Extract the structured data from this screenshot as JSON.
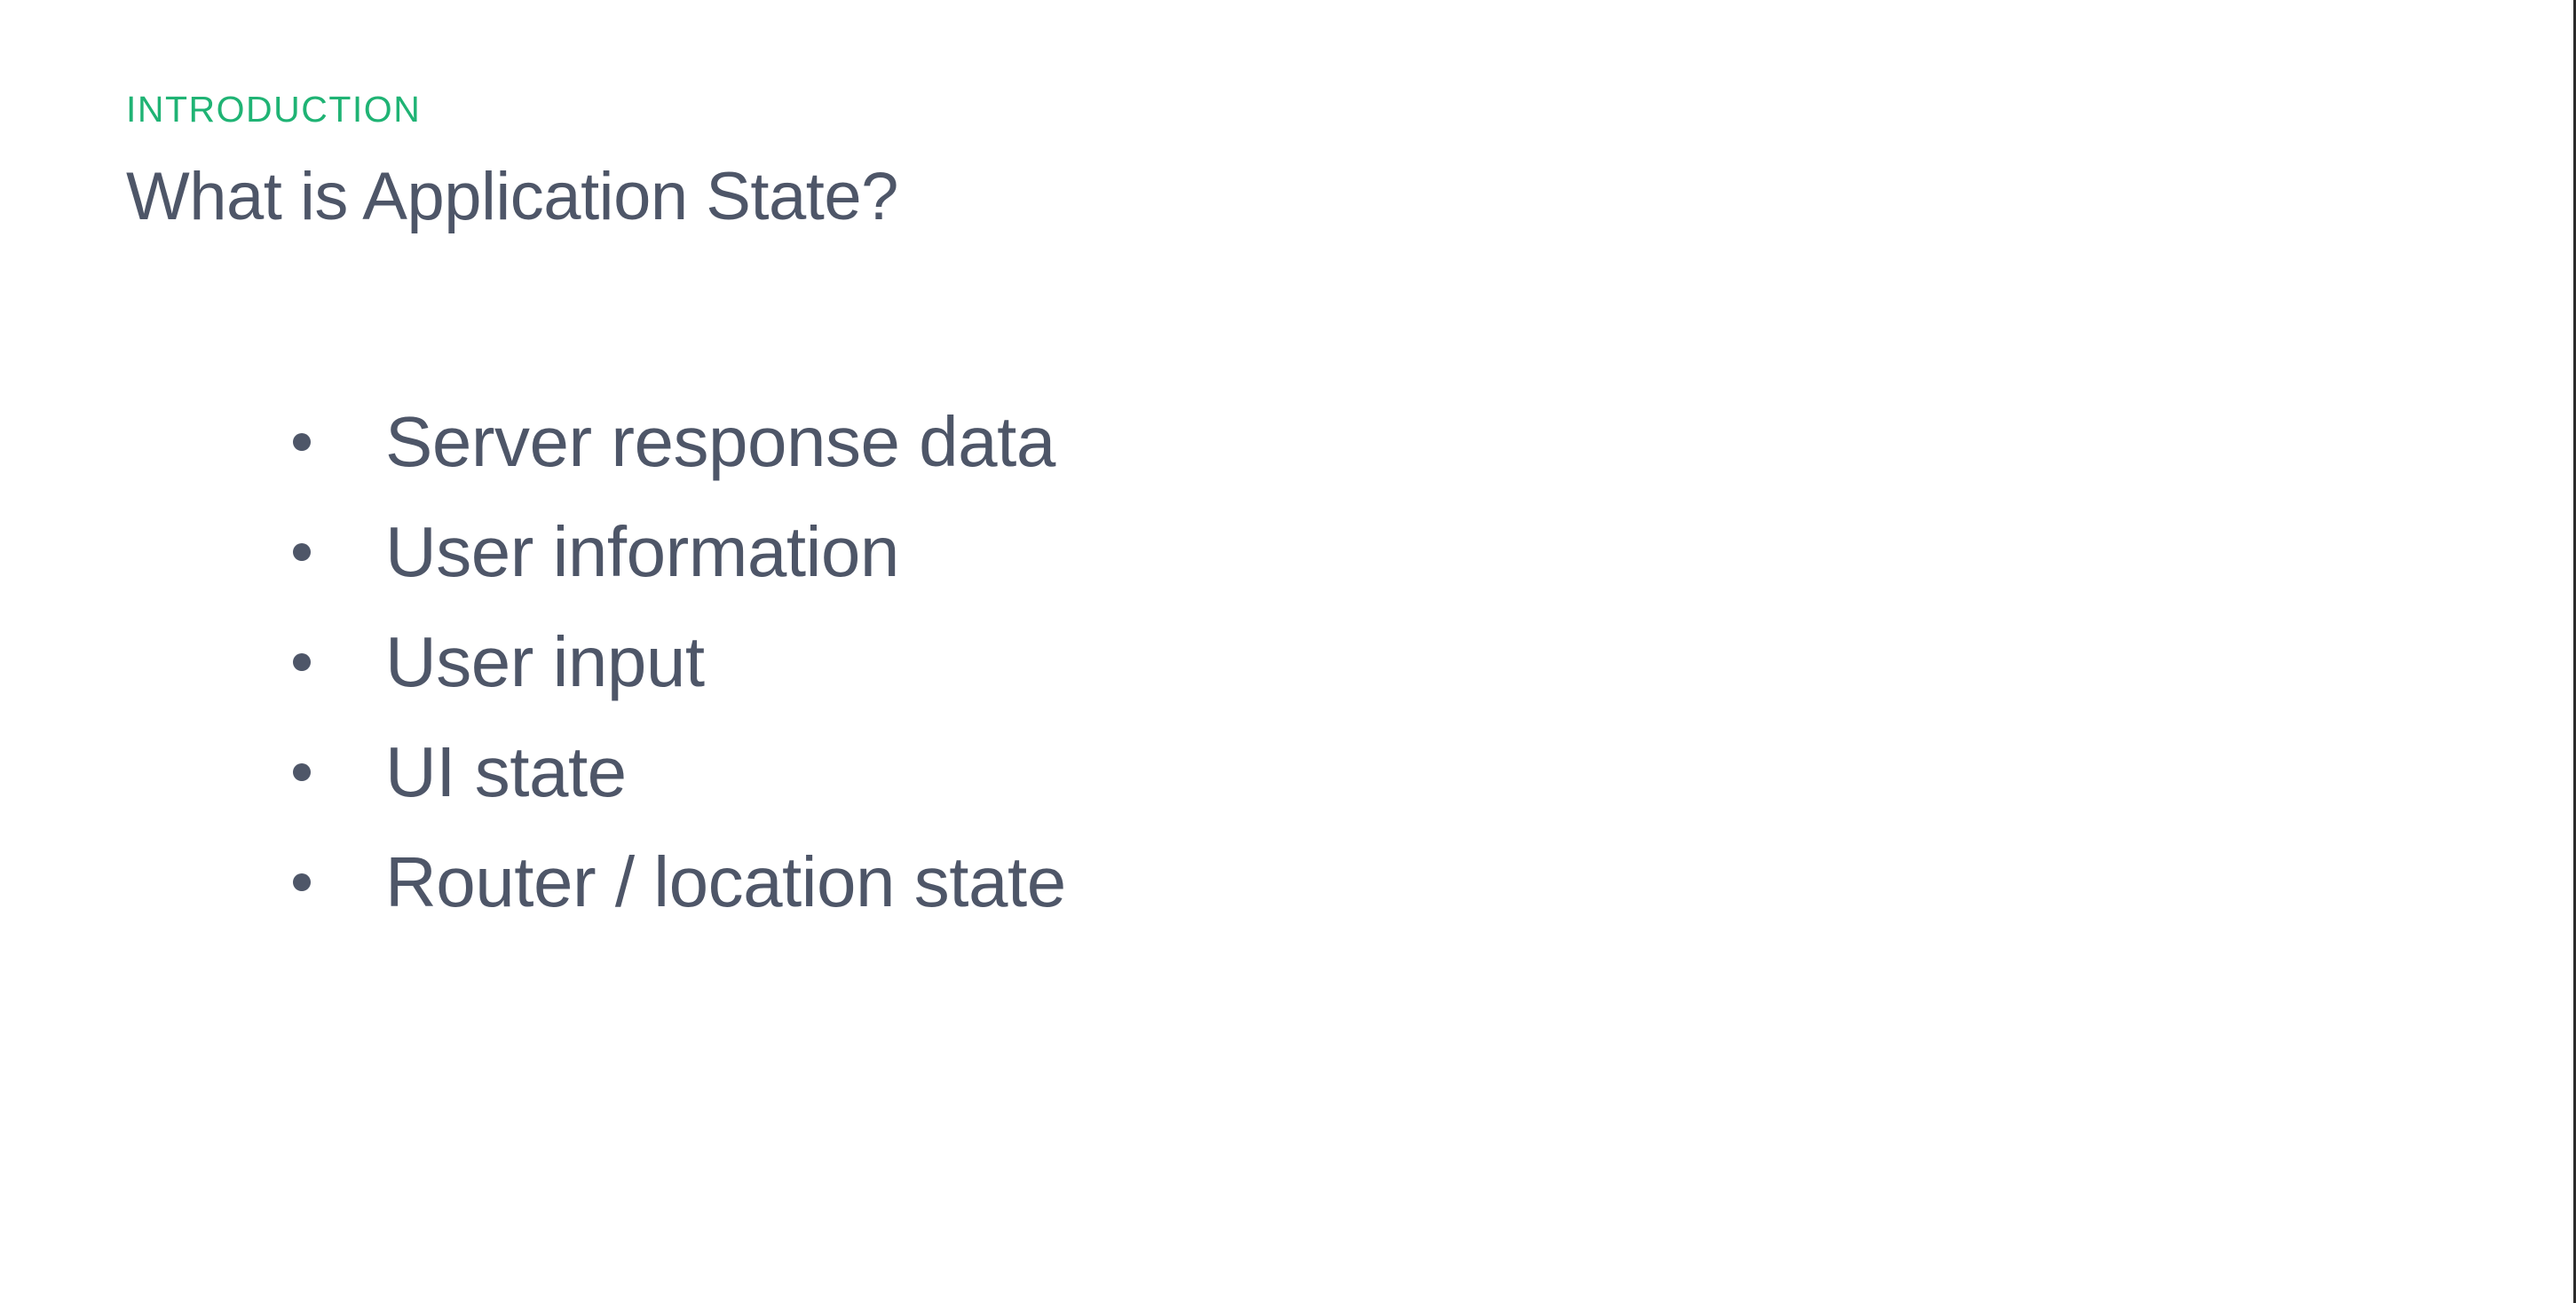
{
  "slide": {
    "eyebrow": "INTRODUCTION",
    "title": "What is Application State?",
    "bullets": [
      "Server response data",
      "User information",
      "User input",
      "UI state",
      "Router / location state"
    ]
  },
  "colors": {
    "accent": "#1fb374",
    "text": "#4e5668",
    "background": "#ffffff"
  }
}
